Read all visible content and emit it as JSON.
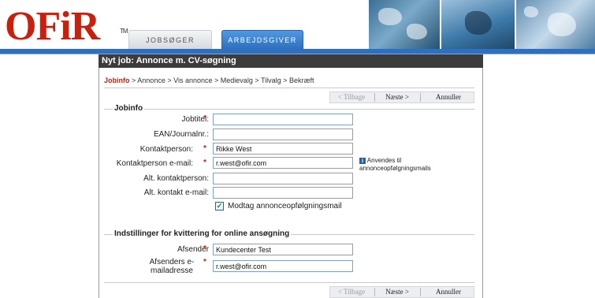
{
  "header": {
    "logo": "OFiR",
    "logo_tm": "TM",
    "tabs": [
      {
        "label": "JOBSØGER"
      },
      {
        "label": "ARBEJDSGIVER"
      }
    ]
  },
  "page": {
    "title": "Nyt job: Annonce m. CV-søgning"
  },
  "breadcrumb": {
    "items": [
      "Jobinfo",
      "Annonce",
      "Vis annonce",
      "Medievalg",
      "Tilvalg",
      "Bekræft"
    ],
    "separator": ">"
  },
  "nav_buttons": {
    "back": "< Tilbage",
    "next": "Næste >",
    "cancel": "Annuller"
  },
  "jobinfo": {
    "section_label": "Jobinfo",
    "fields": [
      {
        "label": "Jobtitel:",
        "required": "*",
        "value": ""
      },
      {
        "label": "EAN/Journalnr.:",
        "required": "",
        "value": ""
      },
      {
        "label": "Kontaktperson:",
        "required": "*",
        "value": "Rikke West"
      },
      {
        "label": "Kontaktperson e-mail:",
        "required": "*",
        "value": "r.west@ofir.com"
      },
      {
        "label": "Alt. kontaktperson:",
        "required": "",
        "value": ""
      },
      {
        "label": "Alt. kontakt e-mail:",
        "required": "",
        "value": ""
      }
    ],
    "info_text": "Anvendes til annonceopfølgningsmails",
    "info_icon": "i",
    "checkbox_label": "Modtag annonceopfølgningsmail",
    "checkbox_checked": true
  },
  "receipt": {
    "section_label": "Indstillinger for kvittering for online ansøgning",
    "fields": [
      {
        "label": "Afsender",
        "required": "*",
        "value": "Kundecenter Test"
      },
      {
        "label": "Afsenders e-mailadresse",
        "required": "*",
        "value": "r.west@ofir.com"
      }
    ]
  },
  "colors": {
    "brand_red": "#c8200f",
    "tab_active": "#2f6fbf",
    "title_bar": "#3c3c3c",
    "input_border": "#7fa2cc"
  }
}
